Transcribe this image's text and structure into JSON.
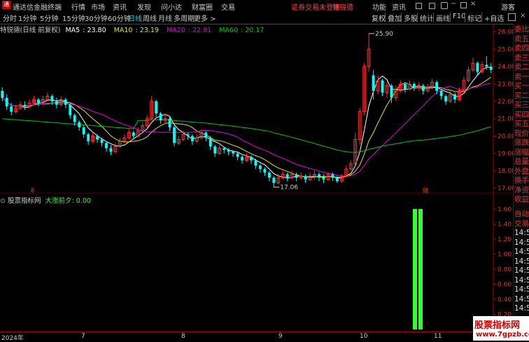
{
  "app": {
    "title": "通达信金融终端",
    "menu": [
      "行情",
      "市场",
      "资讯",
      "发现",
      "问小达",
      "财富圈",
      "交易"
    ],
    "login_status": "证券交易未登录",
    "stock_tag": "特锐德",
    "right_tools": [
      "功能",
      "资讯"
    ],
    "user": "游客",
    "logo_text": "通"
  },
  "toolbar": {
    "timeframes": [
      "分时",
      "1分钟",
      "5分钟",
      "15分钟",
      "30分钟",
      "60分钟",
      "日线",
      "周线",
      "月线",
      "多周期",
      "更多 >"
    ],
    "active_timeframe": "日线",
    "tools": [
      "复权",
      "叠加",
      "多股",
      "统计",
      "画线",
      "F10",
      "标记",
      "+自选"
    ]
  },
  "chart_header": {
    "stock_label": "特锐德(日线 前复权)",
    "ma": [
      {
        "name": "MA5",
        "value": "23.80",
        "color": "#ffffff"
      },
      {
        "name": "MA10",
        "value": "23.19",
        "color": "#e6e600"
      },
      {
        "name": "MA20",
        "value": "22.81",
        "color": "#e600e6"
      },
      {
        "name": "MA60",
        "value": "20.17",
        "color": "#00c800"
      }
    ]
  },
  "price_axis": {
    "ticks": [
      "26.00",
      "25.00",
      "24.00",
      "23.00",
      "22.00",
      "21.00",
      "20.00",
      "19.00",
      "18.00",
      "17.00"
    ]
  },
  "annotations": {
    "high": "25.90",
    "low": "17.06",
    "marker_left": "8",
    "marker_fin": "财"
  },
  "indicator": {
    "name": "股票指标网",
    "series_label": "大涨前夕",
    "series_value": "0.00",
    "ticks": [
      "1.60",
      "1.40",
      "1.20",
      "1.00",
      "0.80",
      "0.60",
      "0.40",
      "0.20"
    ]
  },
  "right_panel": {
    "labels": [
      "委比",
      "卖五",
      "卖四",
      "卖三",
      "卖二",
      "卖一",
      "买一",
      "买二",
      "买三",
      "买四",
      "买五",
      "现价",
      "涨跌",
      "涨幅",
      "总量",
      "外盘",
      "换手",
      "净资",
      "收益"
    ],
    "labels2": [
      "自动",
      "交易",
      "14:5",
      "14:5",
      "14:5",
      "14:5",
      "14:5",
      "14:5",
      "14:5",
      "14:5",
      "14:5"
    ]
  },
  "date_axis": [
    "2024年",
    "7",
    "8",
    "9",
    "10",
    "11"
  ],
  "watermark": {
    "line1": "股票指标网",
    "line2": "www.7gpzb.com"
  },
  "colors": {
    "up": "#ff3333",
    "down": "#00ffff",
    "signal": "#33ff33",
    "axis": "#aa0000"
  },
  "chart_data": {
    "type": "candlestick",
    "ylim": [
      16.8,
      26.3
    ],
    "candles": [
      [
        22.6,
        22.2,
        22.8,
        22.0
      ],
      [
        22.2,
        21.7,
        22.4,
        21.5
      ],
      [
        21.7,
        21.4,
        21.9,
        21.2
      ],
      [
        21.4,
        21.6,
        21.8,
        21.3
      ],
      [
        21.6,
        21.8,
        22.0,
        21.5
      ],
      [
        21.8,
        21.7,
        22.0,
        21.5
      ],
      [
        21.7,
        21.9,
        22.1,
        21.6
      ],
      [
        21.9,
        22.1,
        22.3,
        21.8
      ],
      [
        22.1,
        21.9,
        22.2,
        21.7
      ],
      [
        21.9,
        22.1,
        22.3,
        21.8
      ],
      [
        22.1,
        22.3,
        22.5,
        22.0
      ],
      [
        22.3,
        22.0,
        22.4,
        21.8
      ],
      [
        22.0,
        21.8,
        22.2,
        21.6
      ],
      [
        21.8,
        22.1,
        22.3,
        21.7
      ],
      [
        22.1,
        21.8,
        22.2,
        21.6
      ],
      [
        21.8,
        21.2,
        21.9,
        21.0
      ],
      [
        21.2,
        20.8,
        21.3,
        20.6
      ],
      [
        20.8,
        20.5,
        20.9,
        20.3
      ],
      [
        20.5,
        20.1,
        20.6,
        19.9
      ],
      [
        20.1,
        19.7,
        20.2,
        19.5
      ],
      [
        19.7,
        20.0,
        20.2,
        19.6
      ],
      [
        20.0,
        19.8,
        20.1,
        19.6
      ],
      [
        19.8,
        19.6,
        19.9,
        19.4
      ],
      [
        19.6,
        19.3,
        19.7,
        19.1
      ],
      [
        19.3,
        19.1,
        19.5,
        18.9
      ],
      [
        19.1,
        19.4,
        19.6,
        19.0
      ],
      [
        19.4,
        19.7,
        19.9,
        19.3
      ],
      [
        19.7,
        19.9,
        20.1,
        19.6
      ],
      [
        19.9,
        20.2,
        20.4,
        19.8
      ],
      [
        20.2,
        20.0,
        20.3,
        19.8
      ],
      [
        20.0,
        20.3,
        20.5,
        19.9
      ],
      [
        20.3,
        20.6,
        20.8,
        20.2
      ],
      [
        20.6,
        21.0,
        21.2,
        20.5
      ],
      [
        21.0,
        22.0,
        22.3,
        20.9
      ],
      [
        22.0,
        21.3,
        22.1,
        21.1
      ],
      [
        21.3,
        20.9,
        21.4,
        20.7
      ],
      [
        20.9,
        21.0,
        21.3,
        20.7
      ],
      [
        21.0,
        20.5,
        21.1,
        20.3
      ],
      [
        20.5,
        19.6,
        20.6,
        19.4
      ],
      [
        19.6,
        19.8,
        20.0,
        19.5
      ],
      [
        19.8,
        20.1,
        20.3,
        19.7
      ],
      [
        20.1,
        20.0,
        20.2,
        19.8
      ],
      [
        20.0,
        19.7,
        20.1,
        19.5
      ],
      [
        19.7,
        19.9,
        20.1,
        19.6
      ],
      [
        19.9,
        20.2,
        20.4,
        19.8
      ],
      [
        20.2,
        19.9,
        20.3,
        19.7
      ],
      [
        19.9,
        19.4,
        20.0,
        19.2
      ],
      [
        19.4,
        19.0,
        19.5,
        18.8
      ],
      [
        19.0,
        19.3,
        19.5,
        18.9
      ],
      [
        19.3,
        19.2,
        19.4,
        19.0
      ],
      [
        19.2,
        19.1,
        19.3,
        18.9
      ],
      [
        19.1,
        19.0,
        19.2,
        18.8
      ],
      [
        19.0,
        18.8,
        19.1,
        18.6
      ],
      [
        18.8,
        18.6,
        18.9,
        18.4
      ],
      [
        18.6,
        18.8,
        19.0,
        18.5
      ],
      [
        18.8,
        18.6,
        18.9,
        18.4
      ],
      [
        18.6,
        18.3,
        18.7,
        18.1
      ],
      [
        18.3,
        18.1,
        18.4,
        17.9
      ],
      [
        18.1,
        17.9,
        18.2,
        17.7
      ],
      [
        17.9,
        17.6,
        18.0,
        17.4
      ],
      [
        17.6,
        17.3,
        17.7,
        17.06
      ],
      [
        17.3,
        17.6,
        17.8,
        17.2
      ],
      [
        17.6,
        17.8,
        18.0,
        17.5
      ],
      [
        17.8,
        17.6,
        17.9,
        17.4
      ],
      [
        17.6,
        17.8,
        18.0,
        17.5
      ],
      [
        17.8,
        17.6,
        17.9,
        17.4
      ],
      [
        17.6,
        17.7,
        17.9,
        17.5
      ],
      [
        17.7,
        17.5,
        17.8,
        17.3
      ],
      [
        17.5,
        17.7,
        17.9,
        17.4
      ],
      [
        17.7,
        17.8,
        18.0,
        17.5
      ],
      [
        17.8,
        17.6,
        17.9,
        17.4
      ],
      [
        17.6,
        17.5,
        17.8,
        17.3
      ],
      [
        17.5,
        17.8,
        17.9,
        17.4
      ],
      [
        17.8,
        17.6,
        17.9,
        17.4
      ],
      [
        17.6,
        17.4,
        17.7,
        17.3
      ],
      [
        17.4,
        17.7,
        17.8,
        17.3
      ],
      [
        17.7,
        18.1,
        18.3,
        17.6
      ],
      [
        18.1,
        18.4,
        18.6,
        18.0
      ],
      [
        18.4,
        19.8,
        20.2,
        18.3
      ],
      [
        19.8,
        21.4,
        21.6,
        19.5
      ],
      [
        21.4,
        24.0,
        24.2,
        21.2
      ],
      [
        24.0,
        25.0,
        25.9,
        23.7
      ],
      [
        23.5,
        22.6,
        23.8,
        22.1
      ],
      [
        22.6,
        23.2,
        23.5,
        22.4
      ],
      [
        23.2,
        22.5,
        23.3,
        22.3
      ],
      [
        22.5,
        22.9,
        23.1,
        22.2
      ],
      [
        22.9,
        22.2,
        23.0,
        21.9
      ],
      [
        22.2,
        22.6,
        22.9,
        22.0
      ],
      [
        22.6,
        23.0,
        23.2,
        22.5
      ],
      [
        23.0,
        22.7,
        23.1,
        22.5
      ],
      [
        22.7,
        23.0,
        23.2,
        22.6
      ],
      [
        23.0,
        22.8,
        23.1,
        22.6
      ],
      [
        22.8,
        22.9,
        23.1,
        22.6
      ],
      [
        22.9,
        22.6,
        23.0,
        22.4
      ],
      [
        22.6,
        22.8,
        23.0,
        22.5
      ],
      [
        22.8,
        23.1,
        23.3,
        22.7
      ],
      [
        23.1,
        22.6,
        23.2,
        22.4
      ],
      [
        22.6,
        22.3,
        22.7,
        22.1
      ],
      [
        22.3,
        22.0,
        22.4,
        21.8
      ],
      [
        22.0,
        22.4,
        22.6,
        21.9
      ],
      [
        22.4,
        22.1,
        22.5,
        21.9
      ],
      [
        22.1,
        22.6,
        22.8,
        22.0
      ],
      [
        22.6,
        23.2,
        23.4,
        22.5
      ],
      [
        23.2,
        23.8,
        24.0,
        23.1
      ],
      [
        23.8,
        24.2,
        24.5,
        23.7
      ],
      [
        24.2,
        23.7,
        24.3,
        23.5
      ],
      [
        23.7,
        24.1,
        24.3,
        23.6
      ],
      [
        24.1,
        24.0,
        24.6,
        23.8
      ],
      [
        24.0,
        23.8,
        24.2,
        23.6
      ]
    ],
    "indicator_bars": [
      {
        "index": 79,
        "value": 1.6
      },
      {
        "index": 80,
        "value": 1.6
      }
    ],
    "indicator_ylim": [
      0,
      1.7
    ]
  }
}
